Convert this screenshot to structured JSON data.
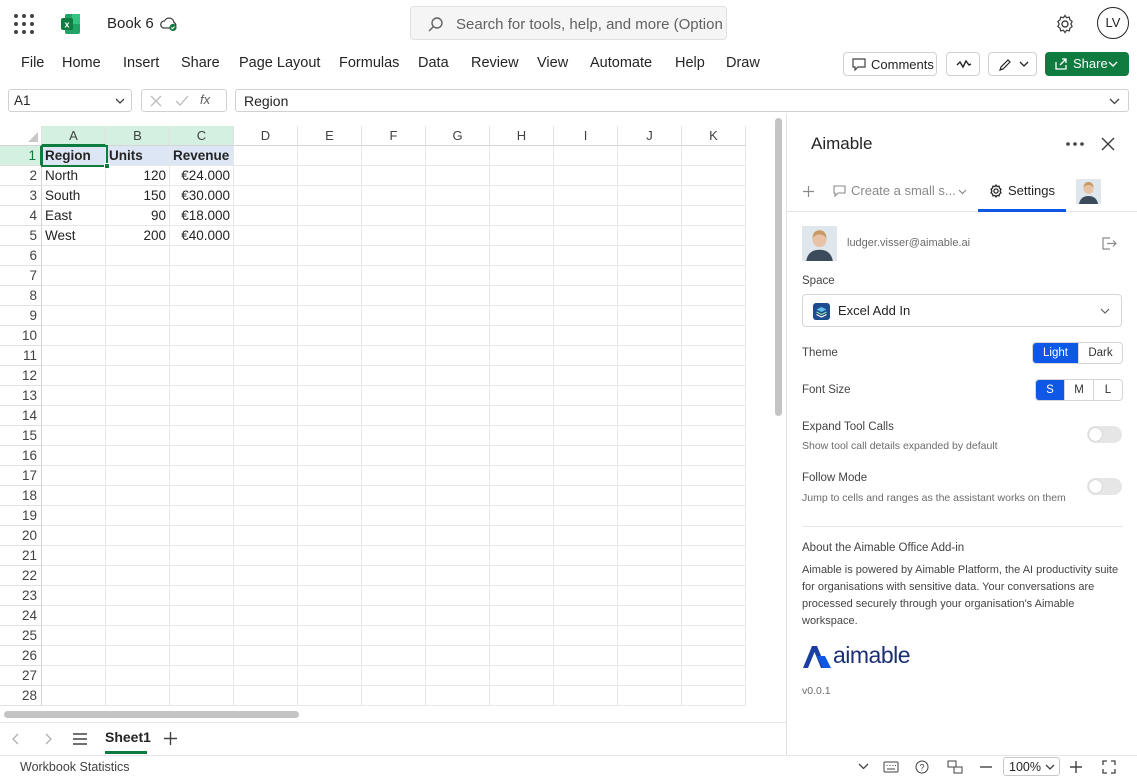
{
  "app": {
    "workbook_title": "Book 6",
    "search_placeholder": "Search for tools, help, and more (Option + Q)",
    "user_initials": "LV"
  },
  "menu": [
    "File",
    "Home",
    "Insert",
    "Share",
    "Page Layout",
    "Formulas",
    "Data",
    "Review",
    "View",
    "Automate",
    "Help",
    "Draw"
  ],
  "toolbar": {
    "comments_label": "Comments",
    "share_label": "Share"
  },
  "formula_bar": {
    "name_box": "A1",
    "formula": "Region"
  },
  "columns": [
    "A",
    "B",
    "C",
    "D",
    "E",
    "F",
    "G",
    "H",
    "I",
    "J",
    "K"
  ],
  "rows": [
    "1",
    "2",
    "3",
    "4",
    "5",
    "6",
    "7",
    "8",
    "9",
    "10",
    "11",
    "12",
    "13",
    "14",
    "15",
    "16",
    "17",
    "18",
    "19",
    "20",
    "21",
    "22",
    "23",
    "24",
    "25",
    "26",
    "27",
    "28"
  ],
  "table": {
    "headers": [
      "Region",
      "Units",
      "Revenue"
    ],
    "data": [
      [
        "North",
        "120",
        "€24.000"
      ],
      [
        "South",
        "150",
        "€30.000"
      ],
      [
        "East",
        "90",
        "€18.000"
      ],
      [
        "West",
        "200",
        "€40.000"
      ]
    ]
  },
  "sheets": {
    "active": "Sheet1"
  },
  "status": {
    "left": "Workbook Statistics",
    "zoom": "100%"
  },
  "pane": {
    "title": "Aimable",
    "conversation_tab": "Create a small s...",
    "settings_tab": "Settings",
    "email": "ludger.visser@aimable.ai",
    "space_label": "Space",
    "space_value": "Excel Add In",
    "theme_label": "Theme",
    "theme_light": "Light",
    "theme_dark": "Dark",
    "font_label": "Font Size",
    "font_s": "S",
    "font_m": "M",
    "font_l": "L",
    "expand_label": "Expand Tool Calls",
    "expand_desc": "Show tool call details expanded by default",
    "follow_label": "Follow Mode",
    "follow_desc": "Jump to cells and ranges as the assistant works on them",
    "about_title": "About the Aimable Office Add-in",
    "about_text": "Aimable is powered by Aimable Platform, the AI productivity suite for organisations with sensitive data. Your conversations are processed securely through your organisation's Aimable workspace.",
    "brand": "aimable",
    "version": "v0.0.1"
  },
  "colors": {
    "accent": "#0f57e5",
    "excel_green": "#0f7b3e",
    "header_selected": "#d3f0e0"
  }
}
